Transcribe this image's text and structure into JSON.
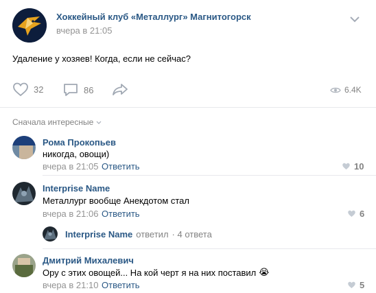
{
  "post": {
    "author": "Хоккейный клуб «Металлург» Магнитогорск",
    "time": "вчера в 21:05",
    "text": "Удаление у хозяев! Когда, если не сейчас?",
    "likes": "32",
    "comments": "86",
    "views": "6.4K"
  },
  "sort_label": "Сначала интересные",
  "reply_label": "Ответить",
  "comments": [
    {
      "author": "Рома Прокопьев",
      "text": "никогда, овощи)",
      "time": "вчера в 21:05",
      "likes": "10"
    },
    {
      "author": "Interprise Name",
      "text": "Металлург вообще Анекдотом стал",
      "time": "вчера в 21:06",
      "likes": "6"
    },
    {
      "author": "Дмитрий Михалевич",
      "text": "Ору с этих овощей... На кой черт я на них поставил",
      "time": "вчера в 21:10",
      "likes": "5"
    }
  ],
  "thread": {
    "author": "Interprise Name",
    "action": "ответил",
    "count": "· 4 ответа"
  },
  "emoji": "😭"
}
